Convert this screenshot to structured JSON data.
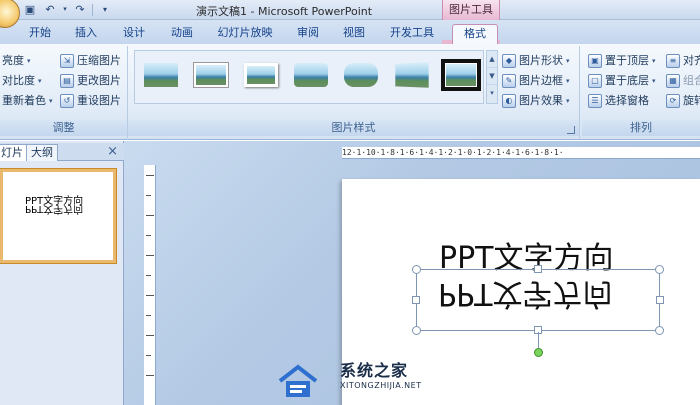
{
  "window": {
    "title": "演示文稿1 - Microsoft PowerPoint",
    "contextual_group": "图片工具",
    "quick_access": [
      "save-icon",
      "undo-icon",
      "redo-icon",
      "customize-icon"
    ]
  },
  "tabs": [
    {
      "label": "开始"
    },
    {
      "label": "插入"
    },
    {
      "label": "设计"
    },
    {
      "label": "动画"
    },
    {
      "label": "幻灯片放映"
    },
    {
      "label": "审阅"
    },
    {
      "label": "视图"
    },
    {
      "label": "开发工具"
    },
    {
      "label": "格式",
      "active": true
    }
  ],
  "ribbon": {
    "adjust": {
      "label": "调整",
      "brightness": "亮度",
      "contrast": "对比度",
      "recolor": "重新着色",
      "compress": "压缩图片",
      "change": "更改图片",
      "reset": "重设图片"
    },
    "styles": {
      "label": "图片样式",
      "shape": "图片形状",
      "border": "图片边框",
      "effects": "图片效果",
      "gallery_count": 7,
      "selected_index": 6
    },
    "arrange": {
      "label": "排列",
      "bring_front": "置于顶层",
      "send_back": "置于底层",
      "selection_pane": "选择窗格",
      "align": "对齐",
      "group": "组合",
      "rotate": "旋转"
    }
  },
  "panel": {
    "tab_slides": "灯片",
    "tab_outline": "大纲",
    "close": "×",
    "thumb_text": "PPT文字方向",
    "thumb_flipped": "PPT文字方向"
  },
  "slide": {
    "text": "PPT文字方向",
    "flipped_text": "PPT文字方向"
  },
  "ruler": {
    "horizontal": "12·1·10·1·8·1·6·1·4·1·2·1·0·1·2·1·4·1·6·1·8·1·"
  },
  "watermark": {
    "cn": "系统之家",
    "en": "XITONGZHIJIA.NET"
  }
}
